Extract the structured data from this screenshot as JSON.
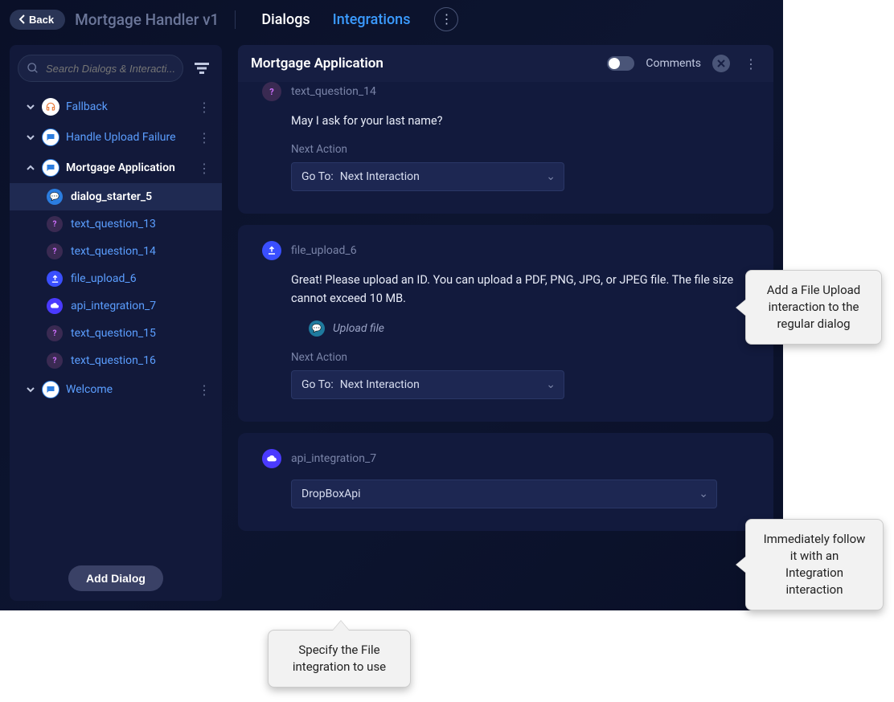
{
  "header": {
    "back": "Back",
    "title": "Mortgage Handler v1",
    "tabs": {
      "dialogs": "Dialogs",
      "integrations": "Integrations"
    }
  },
  "sidebar": {
    "search_placeholder": "Search Dialogs & Interacti...",
    "items": [
      {
        "label": "Fallback"
      },
      {
        "label": "Handle Upload Failure"
      },
      {
        "label": "Mortgage Application",
        "children": [
          {
            "label": "dialog_starter_5",
            "kind": "chat",
            "active": true
          },
          {
            "label": "text_question_13",
            "kind": "q"
          },
          {
            "label": "text_question_14",
            "kind": "q"
          },
          {
            "label": "file_upload_6",
            "kind": "file"
          },
          {
            "label": "api_integration_7",
            "kind": "api"
          },
          {
            "label": "text_question_15",
            "kind": "q"
          },
          {
            "label": "text_question_16",
            "kind": "q"
          }
        ]
      },
      {
        "label": "Welcome"
      }
    ],
    "add_dialog": "Add Dialog"
  },
  "main": {
    "title": "Mortgage Application",
    "comments_label": "Comments",
    "next_action_label": "Next Action",
    "goto_prefix": "Go To:",
    "goto_value": "Next Interaction",
    "cards": {
      "q14": {
        "name": "text_question_14",
        "text": "May I ask for your last name?"
      },
      "file": {
        "name": "file_upload_6",
        "text": "Great! Please upload an ID. You can upload a PDF, PNG, JPG, or JPEG file. The file size cannot exceed 10 MB.",
        "upload_hint": "Upload file"
      },
      "api": {
        "name": "api_integration_7",
        "select_value": "DropBoxApi"
      }
    }
  },
  "callouts": {
    "c1": "Add a File Upload interaction to the regular dialog",
    "c2": "Immediately follow it with an Integration interaction",
    "c3": "Specify the File integration to use"
  }
}
